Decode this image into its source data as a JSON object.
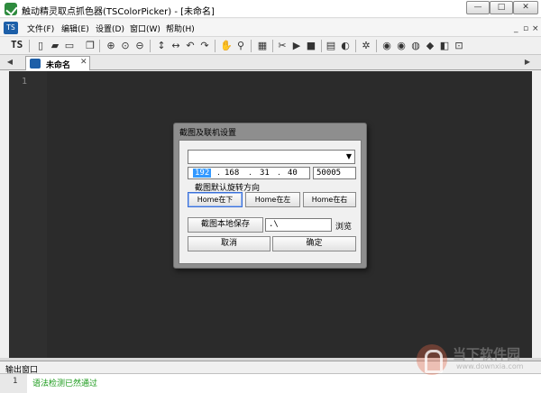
{
  "window": {
    "title": "触动精灵取点抓色器(TSColorPicker) - [未命名]",
    "min_glyph": "—",
    "max_glyph": "□",
    "close_glyph": "✕"
  },
  "menu": {
    "logo": "TS",
    "items": [
      "文件(F)",
      "编辑(E)",
      "设置(D)",
      "窗口(W)",
      "帮助(H)"
    ],
    "mdi_min": "_",
    "mdi_restore": "▫",
    "mdi_close": "×"
  },
  "toolbar": {
    "logo": "TS",
    "icons": [
      "new-file-icon",
      "open-folder-icon",
      "save-icon",
      "copy-icon",
      "zoom-in-icon",
      "zoom-reset-icon",
      "zoom-out-icon",
      "move-vertical-icon",
      "move-horizontal-icon",
      "undo-icon",
      "redo-icon",
      "hand-icon",
      "search-icon",
      "screenshot-icon",
      "cut-icon",
      "play-icon",
      "stop-icon",
      "grid-icon",
      "palette-icon",
      "gear-icon",
      "color-pick-1-icon",
      "color-pick-2-icon",
      "color-pick-3-icon",
      "color-pick-4-icon",
      "color-pick-5-icon",
      "color-pick-6-icon"
    ],
    "glyphs": [
      "▯",
      "▰",
      "▭",
      "❐",
      "⊕",
      "⊙",
      "⊖",
      "↕",
      "↔",
      "↶",
      "↷",
      "✋",
      "⚲",
      "▦",
      "✂",
      "▶",
      "■",
      "▤",
      "◐",
      "✲",
      "◉",
      "◉",
      "◍",
      "◆",
      "◧",
      "⊡"
    ]
  },
  "tabs": {
    "left_arrow": "◀",
    "right_arrow": "▶",
    "active_label": "未命名",
    "close_glyph": "✕"
  },
  "editor": {
    "line_number": "1"
  },
  "output": {
    "title": "输出窗口",
    "line_number": "1",
    "text": "语法检测已然通过"
  },
  "watermark": {
    "text": "当下软件园",
    "url": "www.downxia.com"
  },
  "dialog": {
    "title": "截图及联机设置",
    "combo_value": "",
    "combo_arrow": "▼",
    "ip": [
      "192",
      "168",
      "31",
      "40"
    ],
    "ip_dot": ".",
    "port": "50005",
    "direction_label": "截图默认旋转方向",
    "dir_buttons": [
      "Home在下",
      "Home在左",
      "Home在右"
    ],
    "save_local_button": "截图本地保存",
    "path_value": ".\\",
    "browse_button": "浏览",
    "cancel_button": "取消",
    "ok_button": "确定"
  }
}
